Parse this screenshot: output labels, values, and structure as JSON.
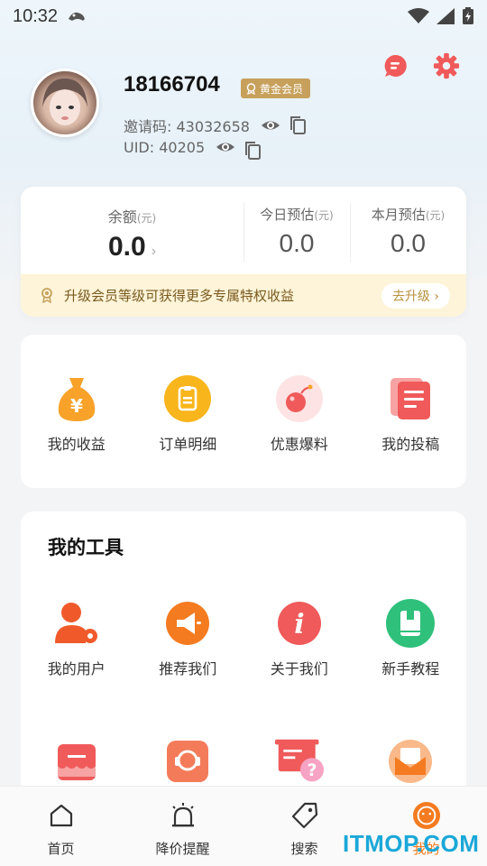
{
  "status_bar": {
    "time": "10:32"
  },
  "profile": {
    "username": "18166704",
    "member_level": "黄金会员",
    "invite_label": "邀请码:",
    "invite_code": "43032658",
    "uid_label": "UID:",
    "uid": "40205"
  },
  "balance": {
    "balance_label": "余额",
    "unit": "(元)",
    "balance_value": "0.0",
    "today_label": "今日预估",
    "today_value": "0.0",
    "month_label": "本月预估",
    "month_value": "0.0",
    "upgrade_text": "升级会员等级可获得更多专属特权收益",
    "upgrade_button": "去升级 ›"
  },
  "quick_actions": [
    {
      "label": "我的收益",
      "icon": "money-bag-icon"
    },
    {
      "label": "订单明细",
      "icon": "clipboard-icon"
    },
    {
      "label": "优惠爆料",
      "icon": "bomb-icon"
    },
    {
      "label": "我的投稿",
      "icon": "document-stack-icon"
    }
  ],
  "tools": {
    "title": "我的工具",
    "items": [
      {
        "label": "我的用户",
        "icon": "user-settings-icon"
      },
      {
        "label": "推荐我们",
        "icon": "megaphone-icon"
      },
      {
        "label": "关于我们",
        "icon": "info-icon"
      },
      {
        "label": "新手教程",
        "icon": "book-icon"
      }
    ],
    "items_row2": [
      {
        "icon": "store-icon"
      },
      {
        "icon": "customer-service-icon"
      },
      {
        "icon": "help-doc-icon"
      },
      {
        "icon": "mail-icon"
      }
    ]
  },
  "bottom_nav": [
    {
      "label": "首页",
      "icon": "home-icon"
    },
    {
      "label": "降价提醒",
      "icon": "alarm-icon"
    },
    {
      "label": "搜索",
      "icon": "tag-icon"
    },
    {
      "label": "我的",
      "icon": "face-icon",
      "active": true
    }
  ],
  "watermark": "ITMOP.COM",
  "colors": {
    "orange": "#f47b20",
    "red": "#f05a5a",
    "gold": "#c7a15c",
    "green": "#2fc07b",
    "yellow": "#f8b51c"
  }
}
